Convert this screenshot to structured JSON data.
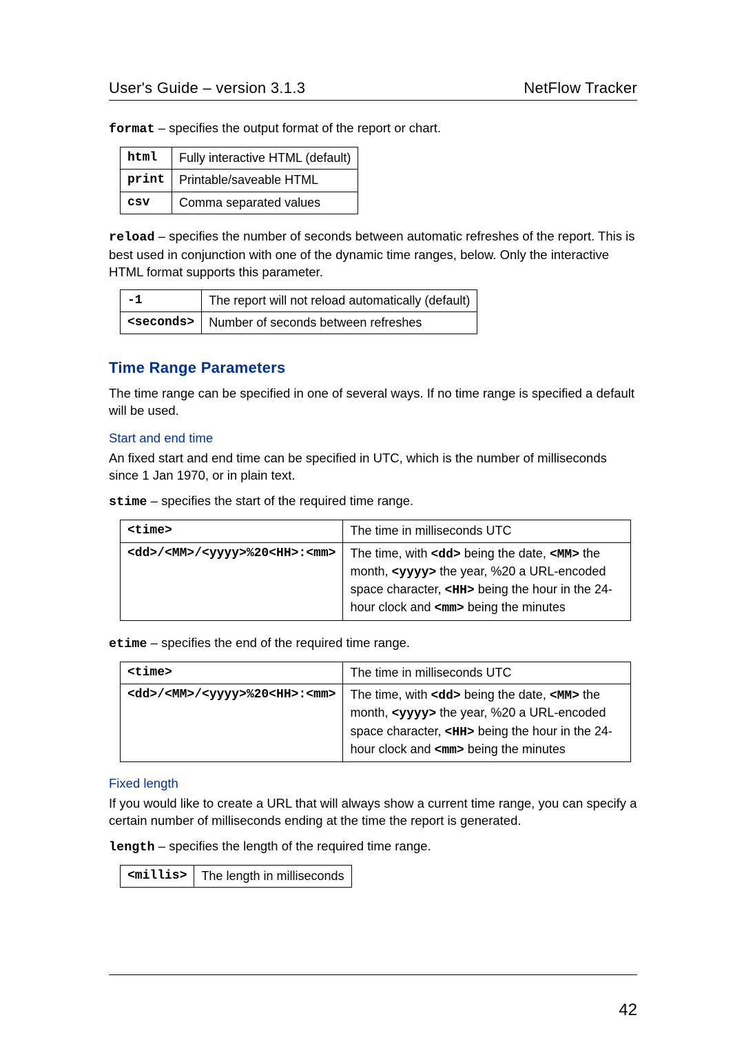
{
  "header": {
    "left": "User's Guide – version 3.1.3",
    "right": "NetFlow Tracker"
  },
  "para_format": {
    "key": "format",
    "text": " – specifies the output format of the report or chart."
  },
  "table_format": [
    {
      "k": "html",
      "v": "Fully interactive HTML (default)"
    },
    {
      "k": "print",
      "v": "Printable/saveable HTML"
    },
    {
      "k": "csv",
      "v": "Comma separated values"
    }
  ],
  "para_reload": {
    "key": "reload",
    "text": " – specifies the number of seconds between automatic refreshes of the report. This is best used in conjunction with one of the dynamic time ranges, below. Only the interactive HTML format supports this parameter."
  },
  "table_reload": [
    {
      "k": "-1",
      "v": "The report will not reload automatically (default)"
    },
    {
      "k": "<seconds>",
      "v": "Number of seconds between refreshes"
    }
  ],
  "section_time": "Time Range Parameters",
  "para_time_intro": "The time range can be specified in one of several ways. If no time range is specified a default will be used.",
  "sub_start": "Start and end time",
  "para_start_intro": "An fixed start and end time can be specified in UTC, which is the number of milliseconds since 1 Jan 1970, or in plain text.",
  "para_stime": {
    "key": "stime",
    "text": " – specifies the start of the required time range."
  },
  "table_stime_etime": {
    "r0k": "<time>",
    "r0v": "The time in milliseconds UTC",
    "r1k": "<dd>/<MM>/<yyyy>%20<HH>:<mm>",
    "r1v_parts": {
      "p0": "The time, with ",
      "dd": "<dd>",
      "p1": " being the date, ",
      "MM": "<MM>",
      "p2": " the month, ",
      "yyyy": "<yyyy>",
      "p3": " the year, %20 a URL-encoded space character, ",
      "HH": "<HH>",
      "p4": " being the hour in the 24-hour clock and ",
      "mm": "<mm>",
      "p5": " being the minutes"
    }
  },
  "para_etime": {
    "key": "etime",
    "text": " – specifies the end of the required time range."
  },
  "sub_fixed": "Fixed length",
  "para_fixed_intro": "If you would like to create a URL that will always show a current time range, you can specify a certain number of milliseconds ending at the time the report is generated.",
  "para_length": {
    "key": "length",
    "text": " – specifies the length of the required time range."
  },
  "table_length": [
    {
      "k": "<millis>",
      "v": "The length in milliseconds"
    }
  ],
  "page_number": "42"
}
